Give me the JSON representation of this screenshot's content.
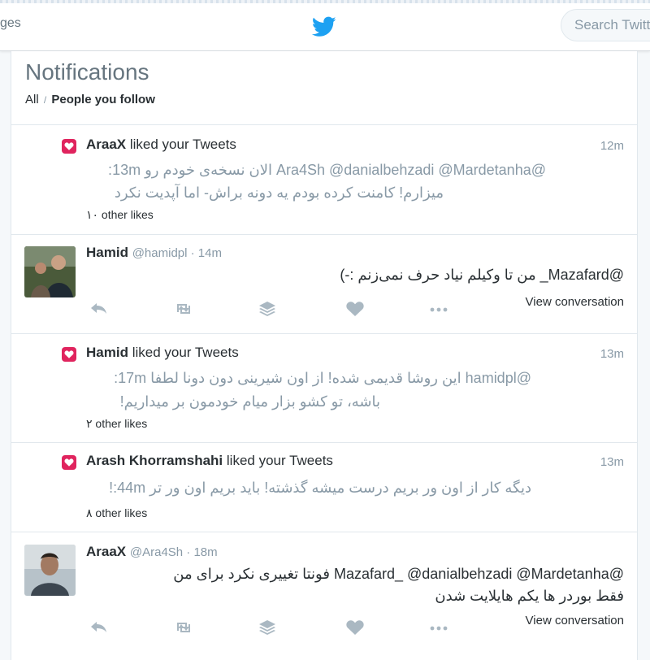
{
  "topbar": {
    "nav_partial": "ges",
    "logo_icon": "twitter-bird-icon",
    "search_placeholder": "Search Twitter"
  },
  "header": {
    "title": "Notifications",
    "filter_all": "All",
    "filter_separator": "/",
    "filter_people": "People you follow"
  },
  "items": [
    {
      "kind": "like",
      "icon": "heart-icon",
      "user": "AraaX",
      "action": " liked your Tweets",
      "time": "12m",
      "text_line1": "@Ara4Sh @danialbehzadi @Mardetanha الان نسخه‌ی خودم رو 13m:",
      "text_line2": "میزارم! کامنت کرده بودم یه دونه براش- اما آپدیت نکرد",
      "other_likes": "۱۰ other likes"
    },
    {
      "kind": "tweet",
      "name": "Hamid",
      "handle": "@hamidpl · 14m",
      "text_line1": "@Mazafard_ من تا وکیلم نیاد حرف نمی‌زنم :-)",
      "view_conversation": "View conversation"
    },
    {
      "kind": "like",
      "icon": "heart-icon",
      "user": "Hamid",
      "action": " liked your Tweets",
      "time": "13m",
      "text_line1": "@hamidpl این روشا قدیمی شده! از اون شیرینی دون دونا لطفا 17m:",
      "text_line2": "باشه، تو کشو بزار میام خودمون بر میداریم!",
      "other_likes": "۲ other likes"
    },
    {
      "kind": "like",
      "icon": "heart-icon",
      "user": "Arash Khorramshahi",
      "action": " liked your Tweets",
      "time": "13m",
      "text_line1": "دیگه کار از اون ور بریم درست میشه گذشته! باید بریم اون ور تر 44m:!",
      "other_likes": "۸ other likes"
    },
    {
      "kind": "tweet",
      "name": "AraaX",
      "handle": "@Ara4Sh · 18m",
      "text_line1": "@Mazafard_ @danialbehzadi @Mardetanha فونتا تغییری نکرد برای من",
      "text_line2": "فقط بوردر ها یکم هایلایت شدن",
      "view_conversation": "View conversation"
    }
  ],
  "action_icons": [
    "reply-icon",
    "retweet-icon",
    "stack-icon",
    "like-icon",
    "more-icon"
  ]
}
